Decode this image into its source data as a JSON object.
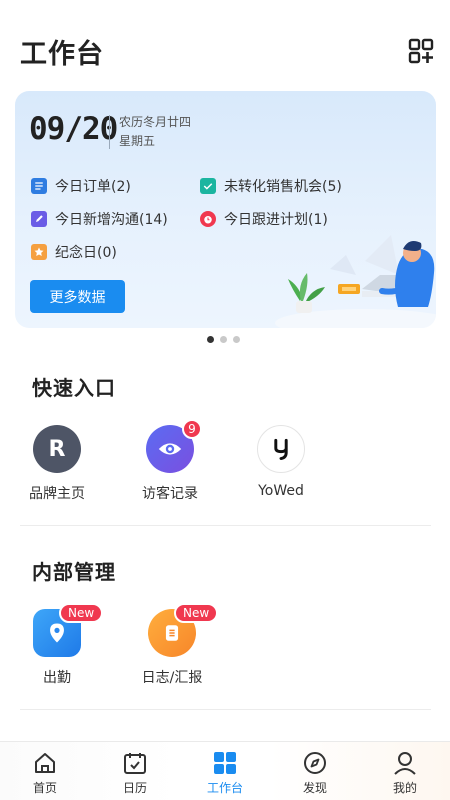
{
  "header": {
    "title": "工作台",
    "scan_icon": "grid-scan-icon"
  },
  "card": {
    "date": "09/20",
    "lunar": "农历冬月廿四",
    "weekday": "星期五",
    "stats": [
      {
        "label": "今日订单(2)",
        "icon": "order-icon",
        "color": "#2f7de1"
      },
      {
        "label": "未转化销售机会(5)",
        "icon": "check-icon",
        "color": "#1bb5a0"
      },
      {
        "label": "今日新增沟通(14)",
        "icon": "edit-icon",
        "color": "#6a5ce6"
      },
      {
        "label": "今日跟进计划(1)",
        "icon": "alarm-icon",
        "color": "#f0384f"
      },
      {
        "label": "纪念日(0)",
        "icon": "star-icon",
        "color": "#f5a040"
      }
    ],
    "more_button": "更多数据"
  },
  "pager": {
    "count": 3,
    "active": 0
  },
  "quick_entry": {
    "title": "快速入口",
    "items": [
      {
        "label": "品牌主页",
        "icon": "brand-r-icon",
        "glyph": "R"
      },
      {
        "label": "访客记录",
        "icon": "eye-icon",
        "badge": "9"
      },
      {
        "label": "YoWed",
        "icon": "yowed-logo-icon",
        "glyph": "Y"
      }
    ]
  },
  "internal": {
    "title": "内部管理",
    "items": [
      {
        "label": "出勤",
        "icon": "location-pin-icon",
        "badge": "New"
      },
      {
        "label": "日志/汇报",
        "icon": "report-icon",
        "badge": "New"
      }
    ]
  },
  "tabbar": {
    "active": 2,
    "tabs": [
      {
        "label": "首页",
        "icon": "home-icon"
      },
      {
        "label": "日历",
        "icon": "calendar-icon"
      },
      {
        "label": "工作台",
        "icon": "workbench-icon"
      },
      {
        "label": "发现",
        "icon": "compass-icon"
      },
      {
        "label": "我的",
        "icon": "profile-icon"
      }
    ]
  }
}
